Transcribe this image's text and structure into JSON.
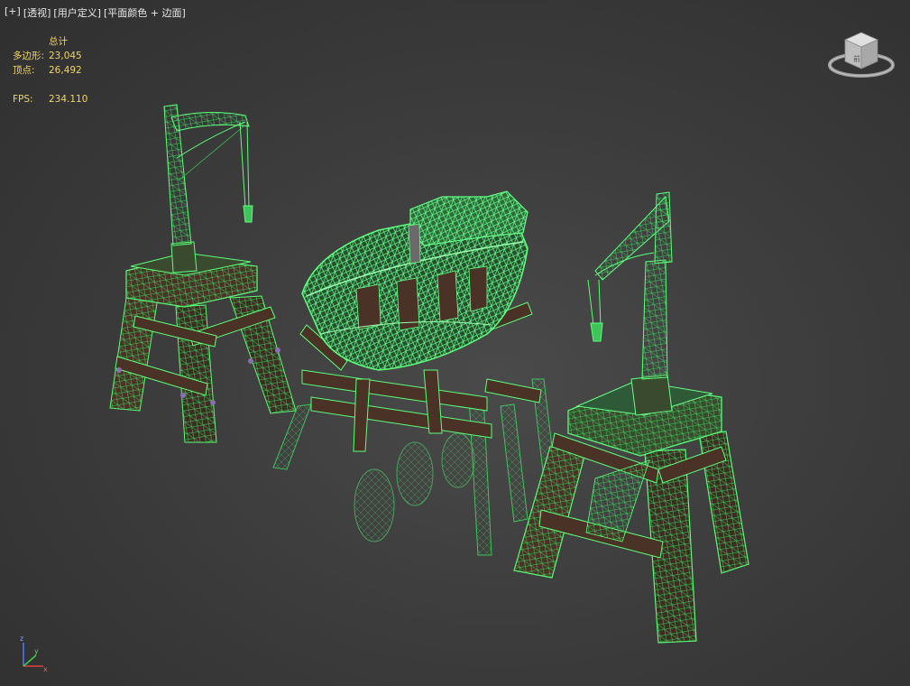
{
  "viewport": {
    "labels": [
      "[+]",
      "[透视]",
      "[用户定义]",
      "[平面颜色 + 边面]"
    ]
  },
  "stats": {
    "header": "总计",
    "polygons_label": "多边形:",
    "polygons_value": "23,045",
    "vertices_label": "顶点:",
    "vertices_value": "26,492",
    "fps_label": "FPS:",
    "fps_value": "234.110"
  },
  "viewcube": {
    "face_label": "前"
  },
  "axis_tripod": {
    "z": "z",
    "x": "x",
    "y": "y"
  },
  "colors": {
    "wire_bright": "#5cff7a",
    "wire_mid": "#3ec45a",
    "wire_dim": "#2f7f3f",
    "wood": "#4a3226",
    "stats_text": "#f0d46a"
  },
  "scene_objects": [
    "crane-left",
    "boat-on-cradle",
    "crane-right"
  ]
}
